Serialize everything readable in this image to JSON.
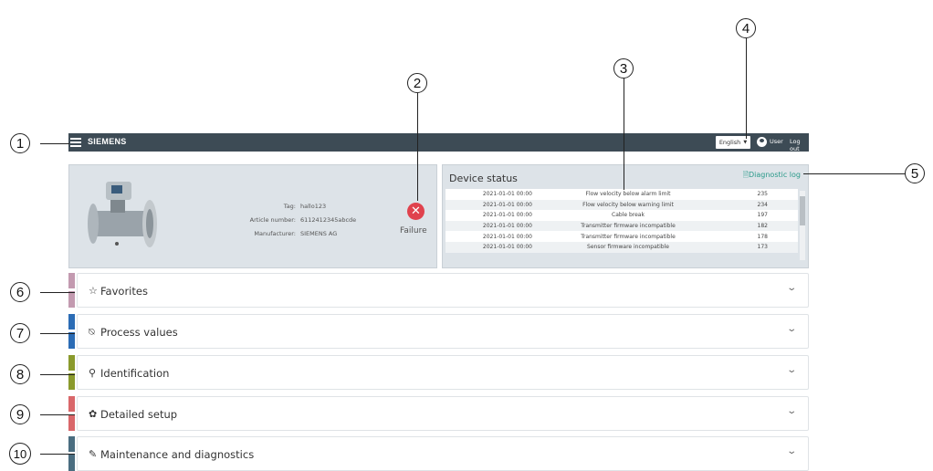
{
  "header": {
    "brand": "SIEMENS",
    "language": "English",
    "user_label": "User",
    "logout_label": "Log out"
  },
  "device": {
    "fields": [
      {
        "key": "Tag:",
        "value": "hallo123"
      },
      {
        "key": "Article number:",
        "value": "6112412345abcde"
      },
      {
        "key": "Manufacturer:",
        "value": "SIEMENS AG"
      }
    ],
    "status_label": "Failure",
    "status_icon": "✕"
  },
  "status": {
    "title": "Device status",
    "diag_link": "Diagnostic log",
    "rows": [
      {
        "time": "2021-01-01 00:00",
        "message": "Flow velocity below alarm limit",
        "code": "235"
      },
      {
        "time": "2021-01-01 00:00",
        "message": "Flow velocity below warning limit",
        "code": "234"
      },
      {
        "time": "2021-01-01 00:00",
        "message": "Cable break",
        "code": "197"
      },
      {
        "time": "2021-01-01 00:00",
        "message": "Transmitter firmware incompatible",
        "code": "182"
      },
      {
        "time": "2021-01-01 00:00",
        "message": "Transmitter firmware incompatible",
        "code": "178"
      },
      {
        "time": "2021-01-01 00:00",
        "message": "Sensor firmware incompatible",
        "code": "173"
      }
    ]
  },
  "sections": [
    {
      "label": "Favorites",
      "icon": "☆",
      "color": "#c39ab0"
    },
    {
      "label": "Process values",
      "icon": "⍉",
      "color": "#2b6cb5"
    },
    {
      "label": "Identification",
      "icon": "⚲",
      "color": "#8a9a2c"
    },
    {
      "label": "Detailed setup",
      "icon": "✿",
      "color": "#d9676a"
    },
    {
      "label": "Maintenance and diagnostics",
      "icon": "✎",
      "color": "#4a6d80"
    }
  ],
  "callouts": [
    "1",
    "2",
    "3",
    "4",
    "5",
    "6",
    "7",
    "8",
    "9",
    "10"
  ]
}
